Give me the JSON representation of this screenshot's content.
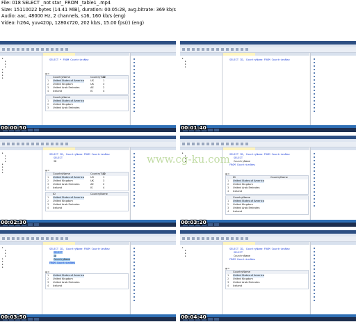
{
  "header": {
    "line1": "File: 018 SELECT _not star_ FROM _table1_.mp4",
    "line2": "Size: 15110022 bytes (14.41 MiB), duration: 00:05:28, avg.bitrate: 369 kb/s",
    "line3": "Audio: aac, 48000 Hz, 2 channels, s16, 160 kb/s (eng)",
    "line4": "Video: h264, yuv420p, 1280x720, 202 kb/s, 15.00 fps(r) (eng)"
  },
  "watermark": "www.cg-ku.com",
  "thumbnails": [
    {
      "timestamp": "00:00:50",
      "query": [
        "SELECT * FROM CountriesNew"
      ],
      "headers": [
        "CountryName",
        "CountryTLD",
        "ID"
      ],
      "rows": [
        {
          "n": "1",
          "name": "United States of America",
          "tld": "US",
          "id": "1"
        },
        {
          "n": "2",
          "name": "United Kingdom",
          "tld": "UK",
          "id": "3"
        },
        {
          "n": "3",
          "name": "United Arab Emirates",
          "tld": "AE",
          "id": "2"
        },
        {
          "n": "4",
          "name": "Iceland",
          "tld": "IS",
          "id": "4"
        }
      ],
      "second_headers": [
        "CountryName"
      ],
      "second_rows": [
        {
          "n": "1",
          "name": "United States of America"
        },
        {
          "n": "2",
          "name": "United Kingdom"
        },
        {
          "n": "3",
          "name": "United Arab Emirates"
        }
      ]
    },
    {
      "timestamp": "00:01:40",
      "query": [
        "SELECT ID, CountryName FROM CountriesNew"
      ],
      "headers": [],
      "rows": [],
      "second_headers": [],
      "second_rows": []
    },
    {
      "timestamp": "00:02:30",
      "query": [
        "SELECT ID, CountryName FROM CountriesNew",
        "SELECT",
        "ID"
      ],
      "headers": [
        "CountryName",
        "CountryTLD",
        "ID"
      ],
      "rows": [
        {
          "n": "1",
          "name": "United States of America",
          "tld": "US",
          "id": "1"
        },
        {
          "n": "2",
          "name": "United Kingdom",
          "tld": "UK",
          "id": "3"
        },
        {
          "n": "3",
          "name": "United Arab Emirates",
          "tld": "AE",
          "id": "2"
        },
        {
          "n": "4",
          "name": "Iceland",
          "tld": "IS",
          "id": "4"
        }
      ],
      "second_headers": [
        "ID",
        "CountryName"
      ],
      "second_rows": [
        {
          "n": "1",
          "name": "United States of America"
        },
        {
          "n": "2",
          "name": "United Kingdom"
        },
        {
          "n": "3",
          "name": "United Arab Emirates"
        },
        {
          "n": "4",
          "name": "Iceland"
        }
      ]
    },
    {
      "timestamp": "00:03:20",
      "query": [
        "SELECT ID, CountryName FROM CountriesNew",
        "SELECT",
        "CountryName",
        "FROM CountriesNew"
      ],
      "headers": [
        "ID",
        "CountryName"
      ],
      "rows": [
        {
          "n": "1",
          "name": "United States of America"
        },
        {
          "n": "2",
          "name": "United Kingdom"
        },
        {
          "n": "3",
          "name": "United Arab Emirates"
        },
        {
          "n": "4",
          "name": "Iceland"
        }
      ],
      "second_headers": [
        "CountryName"
      ],
      "second_rows": [
        {
          "n": "1",
          "name": "United States of America"
        },
        {
          "n": "2",
          "name": "United Kingdom"
        },
        {
          "n": "3",
          "name": "United Arab Emirates"
        },
        {
          "n": "4",
          "name": "Iceland"
        }
      ]
    },
    {
      "timestamp": "00:03:50",
      "query": [
        "SELECT ID, CountryName FROM CountriesNew",
        "SELECT",
        "ID",
        "CountryName",
        "FROM CountriesNew"
      ],
      "headers": [],
      "rows": [
        {
          "n": "1",
          "name": "United States of America"
        },
        {
          "n": "2",
          "name": "United Kingdom"
        },
        {
          "n": "3",
          "name": "United Arab Emirates"
        },
        {
          "n": "4",
          "name": "Iceland"
        }
      ],
      "second_headers": [],
      "second_rows": []
    },
    {
      "timestamp": "00:04:40",
      "query": [
        "SELECT ID, CountryName FROM CountriesNew",
        "SELECT",
        "CountryName",
        "FROM CountriesNew"
      ],
      "headers": [
        "CountryName"
      ],
      "rows": [
        {
          "n": "1",
          "name": "United States of America"
        },
        {
          "n": "2",
          "name": "United Kingdom"
        },
        {
          "n": "3",
          "name": "United Arab Emirates"
        },
        {
          "n": "4",
          "name": "Iceland"
        }
      ],
      "second_headers": [],
      "second_rows": []
    }
  ]
}
